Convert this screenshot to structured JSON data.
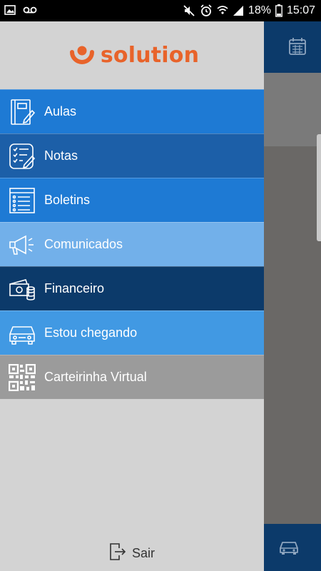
{
  "status_bar": {
    "battery": "18%",
    "time": "15:07"
  },
  "brand": {
    "name": "solution",
    "color": "#e8632a"
  },
  "menu": [
    {
      "label": "Aulas",
      "icon": "notebook-icon",
      "bg": "#1e7ad4"
    },
    {
      "label": "Notas",
      "icon": "checklist-pencil-icon",
      "bg": "#1c5fa8"
    },
    {
      "label": "Boletins",
      "icon": "list-icon",
      "bg": "#1e7ad4"
    },
    {
      "label": "Comunicados",
      "icon": "megaphone-icon",
      "bg": "#72b0ea"
    },
    {
      "label": "Financeiro",
      "icon": "money-icon",
      "bg": "#0c3a6a"
    },
    {
      "label": "Estou chegando",
      "icon": "car-icon",
      "bg": "#4199e3"
    },
    {
      "label": "Carteirinha Virtual",
      "icon": "qr-code-icon",
      "bg": "#9b9b9b"
    }
  ],
  "logout": {
    "label": "Sair",
    "icon": "exit-icon"
  },
  "background_app": {
    "top_icon": "calendar-icon",
    "bottom_icon": "car-icon"
  }
}
